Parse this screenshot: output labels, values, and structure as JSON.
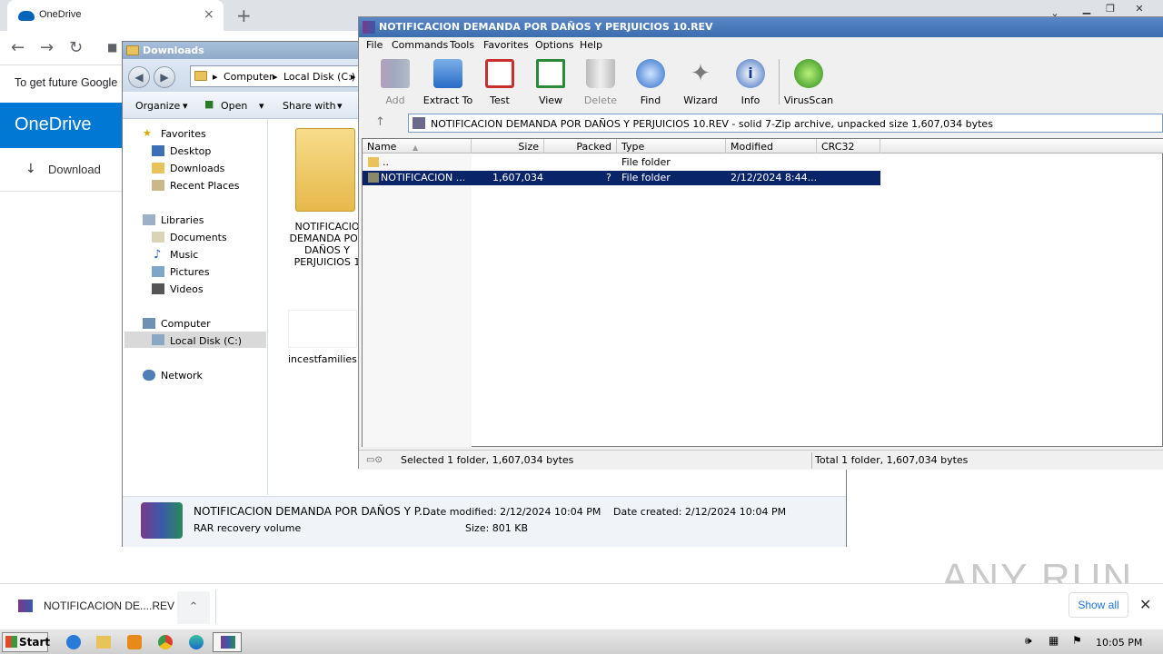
{
  "chrome": {
    "tab_title": "OneDrive",
    "tab_close": "×",
    "new_tab": "+",
    "infobar_text": "To get future Google",
    "onedrive_header": "OneDrive",
    "download_label": "Download",
    "download_icon": "↓"
  },
  "explorer": {
    "title": "Downloads",
    "address": [
      "Computer",
      "Local Disk (C:)"
    ],
    "commands": [
      "Organize",
      "Open",
      "Share with"
    ],
    "nav": {
      "favorites": "Favorites",
      "desktop": "Desktop",
      "downloads": "Downloads",
      "recent": "Recent Places",
      "libraries": "Libraries",
      "documents": "Documents",
      "music": "Music",
      "pictures": "Pictures",
      "videos": "Videos",
      "computer": "Computer",
      "local_disk": "Local Disk (C:)",
      "network": "Network"
    },
    "items": [
      {
        "name_lines": [
          "NOTIFICACIO",
          "DEMANDA POR",
          "DAÑOS Y",
          "PERJUICIOS 1"
        ]
      },
      {
        "name_lines": [
          "incestfamilies.p"
        ]
      }
    ],
    "details": {
      "filename": "NOTIFICACION DEMANDA POR DAÑOS Y P...",
      "type": "RAR recovery volume",
      "date_modified": "Date modified: 2/12/2024 10:04 PM",
      "date_created": "Date created: 2/12/2024 10:04 PM",
      "size": "Size: 801 KB"
    }
  },
  "zip": {
    "title": "NOTIFICACION DEMANDA POR DAÑOS Y PERJUICIOS 10.REV",
    "menu": [
      "File",
      "Commands",
      "Tools",
      "Favorites",
      "Options",
      "Help"
    ],
    "toolbar": [
      {
        "label": "Add",
        "disabled": true
      },
      {
        "label": "Extract To",
        "disabled": false
      },
      {
        "label": "Test",
        "disabled": false
      },
      {
        "label": "View",
        "disabled": false
      },
      {
        "label": "Delete",
        "disabled": true
      },
      {
        "label": "Find",
        "disabled": false
      },
      {
        "label": "Wizard",
        "disabled": false
      },
      {
        "label": "Info",
        "disabled": false
      },
      {
        "label": "VirusScan",
        "disabled": false
      }
    ],
    "path": "NOTIFICACION DEMANDA POR DAÑOS Y PERJUICIOS 10.REV - solid 7-Zip archive, unpacked size 1,607,034 bytes",
    "columns": [
      "Name",
      "Size",
      "Packed",
      "Type",
      "Modified",
      "CRC32"
    ],
    "rows": [
      {
        "name": "..",
        "size": "",
        "packed": "",
        "type": "File folder",
        "modified": "",
        "crc": ""
      },
      {
        "name": "NOTIFICACION ...",
        "size": "1,607,034",
        "packed": "?",
        "type": "File folder",
        "modified": "2/12/2024 8:44...",
        "crc": ""
      }
    ],
    "status_left": "Selected 1 folder, 1,607,034 bytes",
    "status_right": "Total 1 folder, 1,607,034 bytes"
  },
  "shelf": {
    "filename": "NOTIFICACION DE....REV",
    "show_all": "Show all",
    "close": "✕"
  },
  "watermark": "ANY RUN",
  "taskbar": {
    "start": "Start",
    "clock": "10:05 PM"
  }
}
